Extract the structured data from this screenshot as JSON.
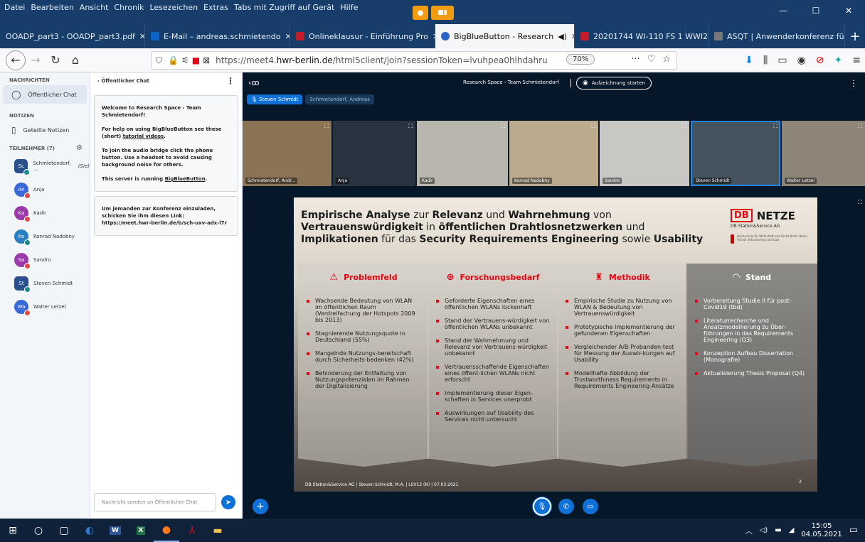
{
  "menu": [
    "Datei",
    "Bearbeiten",
    "Ansicht",
    "Chronik",
    "Lesezeichen",
    "Extras",
    "Tabs mit Zugriff auf Gerät",
    "Hilfe"
  ],
  "window_controls": [
    "—",
    "☐",
    "✕"
  ],
  "tabs": [
    {
      "label": "OOADP_part3 - OOADP_part3.pdf",
      "color": "#173e6b",
      "active": false
    },
    {
      "label": "E-Mail – andreas.schmietendo",
      "color": "#0a64c8",
      "active": false
    },
    {
      "label": "Onlineklausur - Einführung Pro",
      "color": "#c11d2b",
      "active": false
    },
    {
      "label": "BigBlueButton - Research",
      "color": "#2a62c9",
      "active": true
    },
    {
      "label": "20201744 WI-110 FS 1 WWI20",
      "color": "#c11d2b",
      "active": false
    },
    {
      "label": "ASQT | Anwenderkonferenz fü",
      "color": "#777",
      "active": false
    }
  ],
  "nav": {
    "url_prefix": "https://meet4.",
    "url_host": "hwr-berlin.de",
    "url_rest": "/html5client/join?sessionToken=lvuhpea0hlhdahru",
    "zoom": "70%"
  },
  "left": {
    "messages_header": "NACHRICHTEN",
    "public_chat": "Öffentlicher Chat",
    "notes_header": "NOTIZEN",
    "shared_notes": "Geteilte Notizen",
    "participants_header": "TEILNEHMER (7)",
    "users": [
      {
        "initials": "Sc",
        "name": "Schmietendorf, ...",
        "suffix": "(Sie)",
        "color": "#2a4f8a",
        "square": true,
        "status": "mic"
      },
      {
        "initials": "An",
        "name": "Anja",
        "color": "#3a6ad8",
        "square": false,
        "status": "mute"
      },
      {
        "initials": "Ka",
        "name": "Kadir",
        "color": "#9b3aa8",
        "square": false,
        "status": "mute"
      },
      {
        "initials": "Ko",
        "name": "Konrad Nadobny",
        "color": "#2b7ec0",
        "square": false,
        "status": "mic"
      },
      {
        "initials": "Sa",
        "name": "Sandro",
        "color": "#9b3aa8",
        "square": false,
        "status": "mute"
      },
      {
        "initials": "St",
        "name": "Steven Schmidt",
        "color": "#2a4f8a",
        "square": true,
        "status": "mic"
      },
      {
        "initials": "Wa",
        "name": "Walter Letzel",
        "color": "#3a6ad8",
        "square": false,
        "status": "mute"
      }
    ]
  },
  "chat": {
    "title": "Öffentlicher Chat",
    "welcome": "Welcome to Research Space - Team Schmietendorf!",
    "help_pre": "For help on using BigBlueButton see these (short) ",
    "help_link": "tutorial videos",
    "help_post": ".",
    "audio": "To join the audio bridge click the phone button. Use a headset to avoid causing background noise for others.",
    "server_pre": "This server is running ",
    "server_link": "BigBlueButton",
    "server_post": ".",
    "invite": "Um jemanden zur Konferenz einzuladen, schicken Sie ihm diesen Link: https://meet.hwr-berlin.de/b/sch-uxv-adx-l7r",
    "placeholder": "Nachricht senden an Öffentlicher Chat"
  },
  "session": {
    "room": "Research Space - Team Schmietendorf",
    "record": "Aufzeichnung starten",
    "talkers": [
      {
        "name": "Steven Schmidt",
        "color": "#0f70d7"
      },
      {
        "name": "Schmietendorf, Andreas",
        "color": "#173a5c"
      }
    ]
  },
  "videos": [
    {
      "name": "Schmietendorf, Andr...",
      "bg": "#8b7456"
    },
    {
      "name": "Anja",
      "bg": "#2a3440"
    },
    {
      "name": "Kadir",
      "bg": "#b9b6ae"
    },
    {
      "name": "Konrad Nadobny",
      "bg": "#bcaa8e"
    },
    {
      "name": "Sandro",
      "bg": "#c9c7c4"
    },
    {
      "name": "Steven Schmidt",
      "bg": "#44535e"
    },
    {
      "name": "Walter Letzel",
      "bg": "#8f8478"
    }
  ],
  "slide": {
    "title_parts": [
      {
        "t": "Empirische Analyse",
        "b": true
      },
      {
        "t": " zur ",
        "b": false
      },
      {
        "t": "Relevanz",
        "b": true
      },
      {
        "t": " und ",
        "b": false
      },
      {
        "t": "Wahrnehmung",
        "b": true
      },
      {
        "t": " von ",
        "b": false
      },
      {
        "t": "Vertrauenswürdigkeit",
        "b": true
      },
      {
        "t": " in ",
        "b": false
      },
      {
        "t": "öffentlichen Drahtlosnetzwerken",
        "b": true
      },
      {
        "t": " und ",
        "b": false
      },
      {
        "t": "Implikationen",
        "b": true
      },
      {
        "t": " für das ",
        "b": false
      },
      {
        "t": "Security Requirements Engineering",
        "b": true
      },
      {
        "t": " sowie ",
        "b": false
      },
      {
        "t": "Usability",
        "b": true
      }
    ],
    "logo_db": "DB",
    "logo_netze": "NETZE",
    "logo_sub": "DB Station&Service AG",
    "hwr": "Hochschule für Wirtschaft und Recht Berlin Berlin School of Economics and Law",
    "columns": [
      {
        "title": "Problemfeld",
        "icon": "⚠",
        "dark": false,
        "items": [
          "Wachsende Bedeutung von WLAN im öffentlichen Raum (Verdreifachung der Hotspots 2009 bis 2013)",
          "Stagnierende Nutzungsquote in Deutschland (55%)",
          "Mangelnde Nutzungs-bereitschaft durch Sicherheits-bedenken (42%)",
          "Behinderung der Entfaltung von Nutzungspotenzialen im Rahmen der Digitalisierung"
        ]
      },
      {
        "title": "Forschungsbedarf",
        "icon": "⊕",
        "dark": false,
        "items": [
          "Geforderte Eigenschaften eines öffentlichen WLANs lückenhaft",
          "Stand der Vertrauens-würdigkeit von öffentlichen WLANs unbekannt",
          "Stand der Wahrnehmung und Relevanz von Vertrauens-würdigkeit unbekannt",
          "Vertrauensschaffende Eigenschaften eines öffent-lichen WLANs nicht erforscht",
          "Implementierung dieser Eigen-schaften in Services unerprobt",
          "Auswirkungen auf Usability des Services nicht untersucht"
        ]
      },
      {
        "title": "Methodik",
        "icon": "♜",
        "dark": false,
        "items": [
          "Empirische Studie zu Nutzung von WLAN & Bedeutung von Vertrauenswürdigkeit",
          "Prototypische Implementierung der gefundenen Eigenschaften",
          "Vergleichender A/B-Probanden-test für Messung der Auswir-kungen auf Usability",
          "Modellhafte Abbildung der Trustworthiness Requirements in Requirements Engineering Ansätze"
        ]
      },
      {
        "title": "Stand",
        "icon": "◠",
        "dark": true,
        "items": [
          "Vorbereitung Studie II für post-Covid19 (tbd)",
          "Literaturrecherche und Ansatzmodellierung zu Über-führungen in das Requirements Engineering (Q3)",
          "Konzeption Aufbau Dissertation (Monografie)",
          "Aktualisierung Thesis Proposal (Q4)"
        ]
      }
    ],
    "footer": "DB Station&Service AG | Steven Schmidt, M.A. | LSV12 (N) | 07.03.2021",
    "page": "2"
  },
  "taskbar": {
    "time": "15:05",
    "date": "04.05.2021"
  }
}
